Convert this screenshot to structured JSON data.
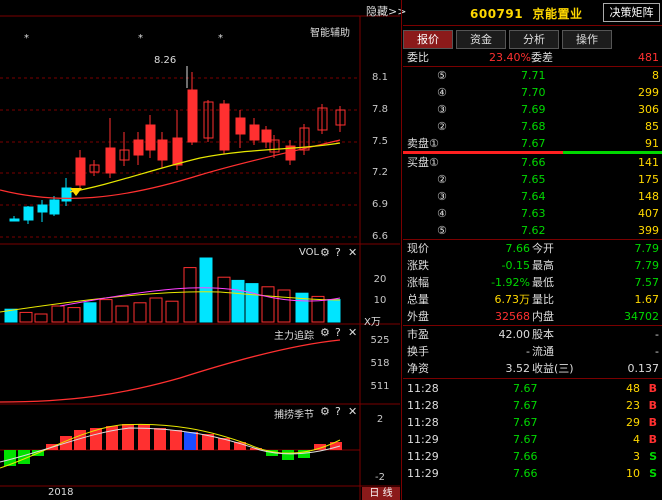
{
  "stock": {
    "code": "600791",
    "name": "京能置业",
    "matrix_button": "决策矩阵"
  },
  "left": {
    "hide_label": "隐藏",
    "hide_arrows": ">>",
    "kline_indicator": "智能辅助",
    "kline_annotation": "8.26",
    "kline_markers": [
      "*",
      "*",
      "*"
    ],
    "kline_axis": [
      "8.1",
      "7.8",
      "7.5",
      "7.2",
      "6.9",
      "6.6"
    ],
    "vol_label": "VOL",
    "vol_axis": [
      "20",
      "10"
    ],
    "vol_unit": "X万",
    "main_label": "主力追踪",
    "main_axis": [
      "525",
      "518",
      "511"
    ],
    "season_label": "捕捞季节",
    "season_axis": [
      "2",
      "-2"
    ],
    "year_label": "2018",
    "period_button": "日 线",
    "gear": "⚙",
    "help": "?",
    "close": "✕"
  },
  "tabs": [
    "报价",
    "资金",
    "分析",
    "操作"
  ],
  "weibi": {
    "label": "委比",
    "value": "23.40%",
    "cha_label": "委差",
    "cha_value": "481"
  },
  "sell": [
    {
      "label": "⑤",
      "price": "7.71",
      "vol": "8"
    },
    {
      "label": "④",
      "price": "7.70",
      "vol": "299"
    },
    {
      "label": "③",
      "price": "7.69",
      "vol": "306"
    },
    {
      "label": "②",
      "price": "7.68",
      "vs": "85"
    },
    {
      "label": "卖盘①",
      "price": "7.67",
      "vol": "91"
    }
  ],
  "buy": [
    {
      "label": "买盘①",
      "price": "7.66",
      "vol": "141"
    },
    {
      "label": "②",
      "price": "7.65",
      "vol": "175"
    },
    {
      "label": "③",
      "price": "7.64",
      "vol": "148"
    },
    {
      "label": "④",
      "price": "7.63",
      "vol": "407"
    },
    {
      "label": "⑤",
      "price": "7.62",
      "vol": "399"
    }
  ],
  "quote": [
    {
      "l1": "现价",
      "v1": "7.66",
      "l2": "今开",
      "v2": "7.79"
    },
    {
      "l1": "涨跌",
      "v1": "-0.15",
      "l2": "最高",
      "v2": "7.79"
    },
    {
      "l1": "涨幅",
      "v1": "-1.92%",
      "l2": "最低",
      "v2": "7.57"
    },
    {
      "l1": "总量",
      "v1": "6.73万",
      "l2": "量比",
      "v2": "1.67"
    },
    {
      "l1": "外盘",
      "v1": "32568",
      "l2": "内盘",
      "v2": "34702"
    }
  ],
  "fund": [
    {
      "l1": "市盈",
      "v1": "42.00",
      "l2": "股本",
      "v2": "-"
    },
    {
      "l1": "换手",
      "v1": "-",
      "l2": "流通",
      "v2": "-"
    },
    {
      "l1": "净资",
      "v1": "3.52",
      "l2": "收益(三)",
      "v2": "0.137"
    }
  ],
  "trades": [
    {
      "time": "11:28",
      "price": "7.67",
      "vol": "48",
      "dir": "B"
    },
    {
      "time": "11:28",
      "price": "7.67",
      "vol": "23",
      "dir": "B"
    },
    {
      "time": "11:28",
      "price": "7.67",
      "vol": "29",
      "dir": "B"
    },
    {
      "time": "11:29",
      "price": "7.67",
      "vol": "4",
      "dir": "B"
    },
    {
      "time": "11:29",
      "price": "7.66",
      "vol": "3",
      "dir": "S"
    },
    {
      "time": "11:29",
      "price": "7.66",
      "vol": "10",
      "dir": "S"
    }
  ],
  "colors": {
    "up": "#ff3030",
    "down": "#00d800",
    "cyan": "#00e5ff",
    "yellow": "#ffd800",
    "grid": "#7a0000"
  }
}
